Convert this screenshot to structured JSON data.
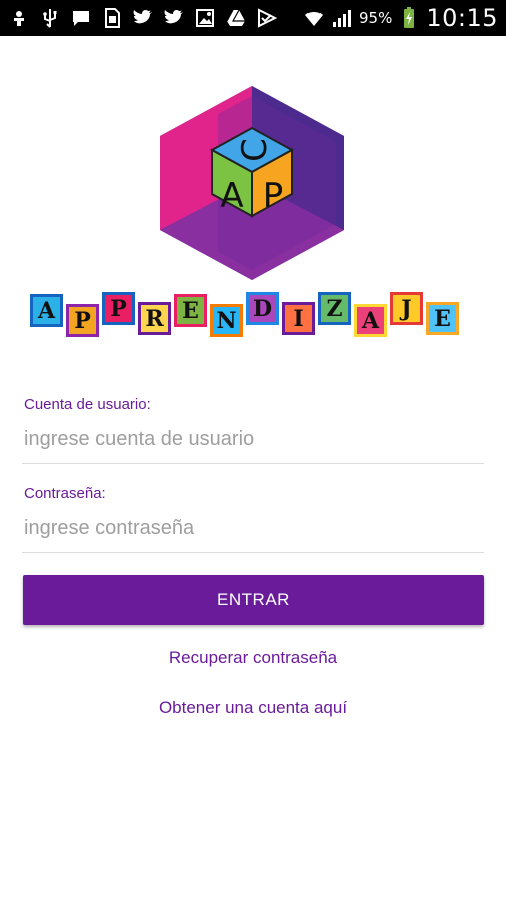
{
  "status_bar": {
    "battery_percent": "95%",
    "time": "10:15",
    "icons": [
      "usb-debug-icon",
      "usb-icon",
      "chat-icon",
      "sim-icon",
      "twitter-icon",
      "twitter-icon",
      "photo-icon",
      "drive-icon",
      "checkmark-icon",
      "wifi-icon",
      "signal-icon",
      "battery-charging-icon"
    ]
  },
  "logo": {
    "cube_letters": [
      "C",
      "A",
      "P"
    ],
    "wordmark_letters": [
      "A",
      "P",
      "P",
      "R",
      "E",
      "N",
      "D",
      "I",
      "Z",
      "A",
      "J",
      "E"
    ],
    "colors": {
      "hex_magenta": "#e0248c",
      "hex_purple": "#5b2a93",
      "hex_bottom": "#8a2fa0",
      "hex_shadow": "#b43fa6"
    }
  },
  "form": {
    "username_label": "Cuenta de usuario:",
    "username_placeholder": "ingrese cuenta de usuario",
    "password_label": "Contraseña:",
    "password_placeholder": "ingrese contraseña",
    "submit_label": "ENTRAR"
  },
  "links": {
    "recover_password": "Recuperar contraseña",
    "get_account": "Obtener una cuenta aquí"
  },
  "theme": {
    "accent": "#6a1b9a"
  }
}
